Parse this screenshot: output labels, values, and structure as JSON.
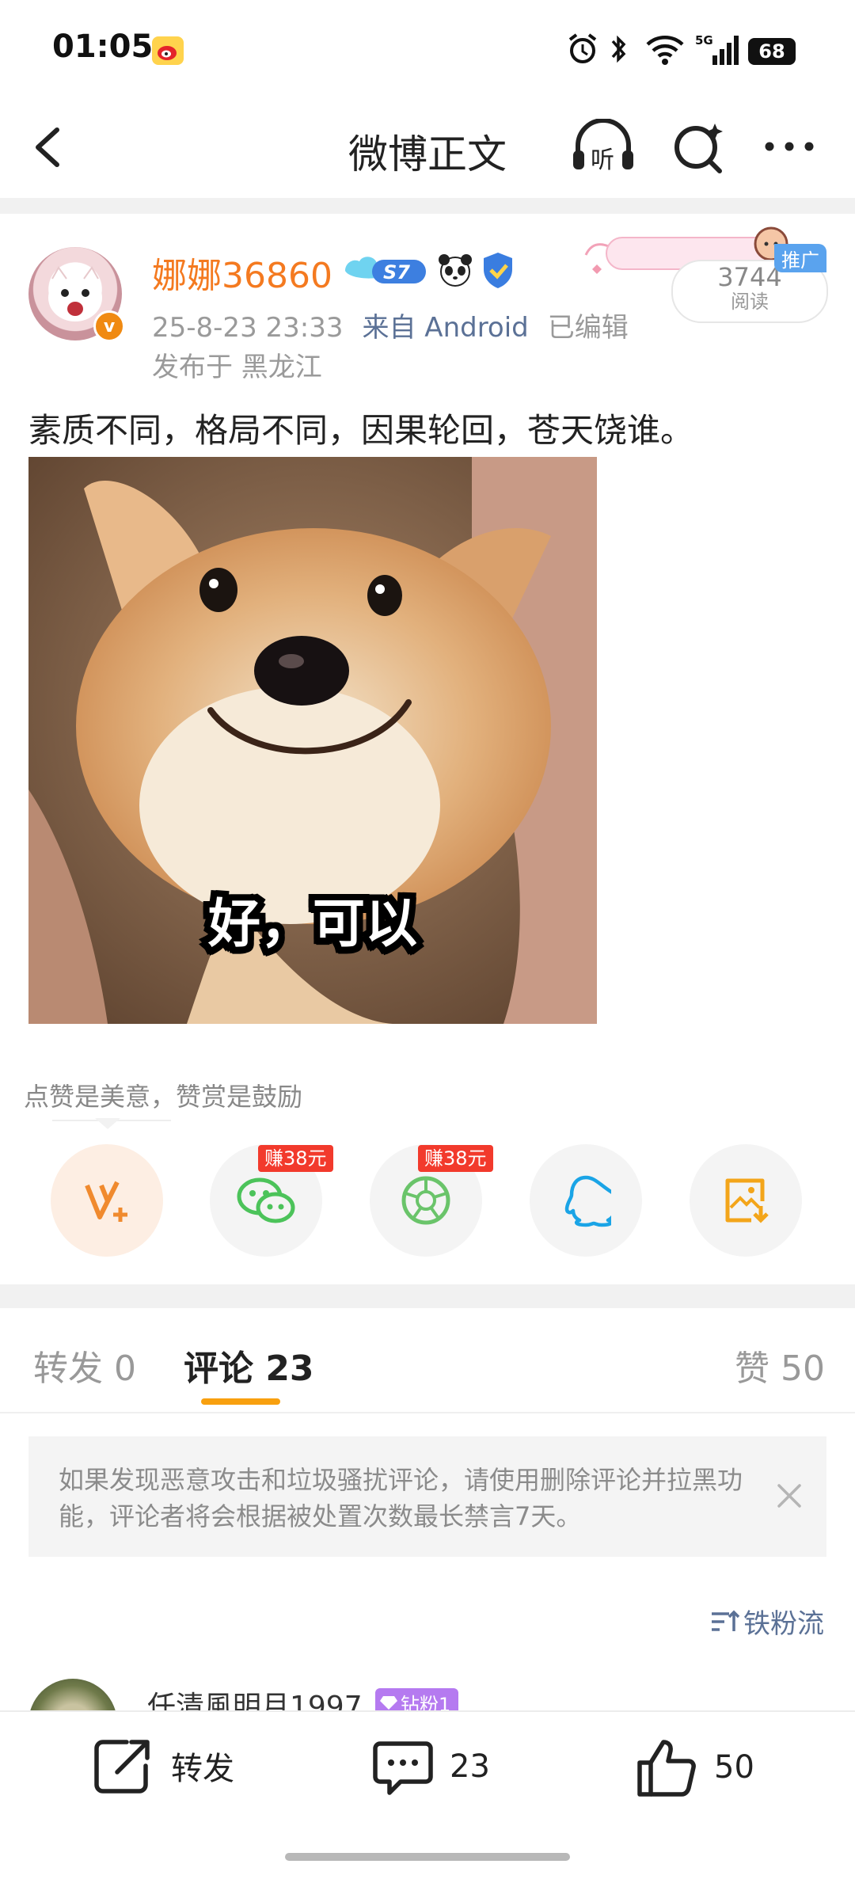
{
  "status_bar": {
    "time": "01:05",
    "battery": "68",
    "network": "5G"
  },
  "nav": {
    "title": "微博正文",
    "listen_label": "听"
  },
  "post": {
    "username": "娜娜36860",
    "level_badge": "S7",
    "time": "25-8-23 23:33",
    "source": "来自 Android",
    "edited": "已编辑",
    "location": "发布于 黑龙江",
    "reads_count": "3744",
    "reads_label": "阅读",
    "promo_badge": "推广",
    "text": "素质不同，格局不同，因果轮回，苍天饶谁。",
    "image_caption": "好，可以"
  },
  "appreciate": {
    "hint": "点赞是美意，赞赏是鼓励",
    "wechat_earn": "赚38元",
    "moments_earn": "赚38元"
  },
  "tabs": {
    "repost": "转发 0",
    "comment": "评论 23",
    "like": "赞 50"
  },
  "notice": {
    "text": "如果发现恶意攻击和垃圾骚扰评论，请使用删除评论并拉黑功能，评论者将会根据被处置次数最长禁言7天。"
  },
  "sort_label": "铁粉流",
  "comment": {
    "name": "任清風明月1997",
    "badge": "钻粉1"
  },
  "bottom_bar": {
    "repost": "转发",
    "comments": "23",
    "likes": "50"
  },
  "colors": {
    "brand_orange": "#f47a20",
    "accent_yellow": "#f8a00f",
    "link_blue": "#5b7196"
  }
}
